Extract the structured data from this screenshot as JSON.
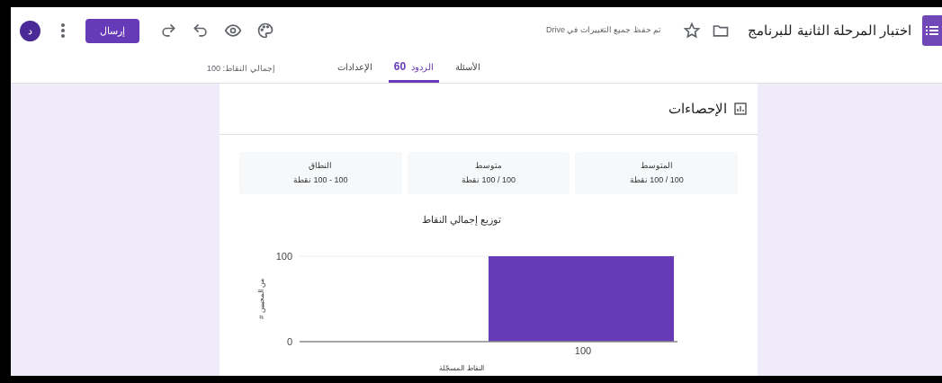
{
  "header": {
    "title": "اختبار المرحلة الثانية للبرنامج",
    "save_status": "تم حفظ جميع التغييرات في Drive",
    "send_button": "إرسال",
    "avatar": "د"
  },
  "tabs": [
    {
      "label": "الأسئلة",
      "selected": false
    },
    {
      "label": "الردود",
      "count": "60",
      "selected": true
    },
    {
      "label": "الإعدادات",
      "selected": false
    }
  ],
  "total_points": "إجمالي النقاط: 100",
  "statistics": {
    "title": "الإحصاءات",
    "cards": [
      {
        "label": "المتوسط",
        "value": "100 / 100 نقطة"
      },
      {
        "label": "متوسط",
        "value": "100 / 100 نقطة"
      },
      {
        "label": "النطاق",
        "value": "100 - 100 نقطة"
      }
    ],
    "chart_data": {
      "type": "bar",
      "title": "توزيع إجمالي النقاط",
      "xlabel": "النقاط المسجّلة",
      "ylabel": "# من المجيبين",
      "categories": [
        "100"
      ],
      "values": [
        100
      ],
      "ylim": [
        0,
        100
      ],
      "yticks": [
        0,
        100
      ]
    }
  }
}
